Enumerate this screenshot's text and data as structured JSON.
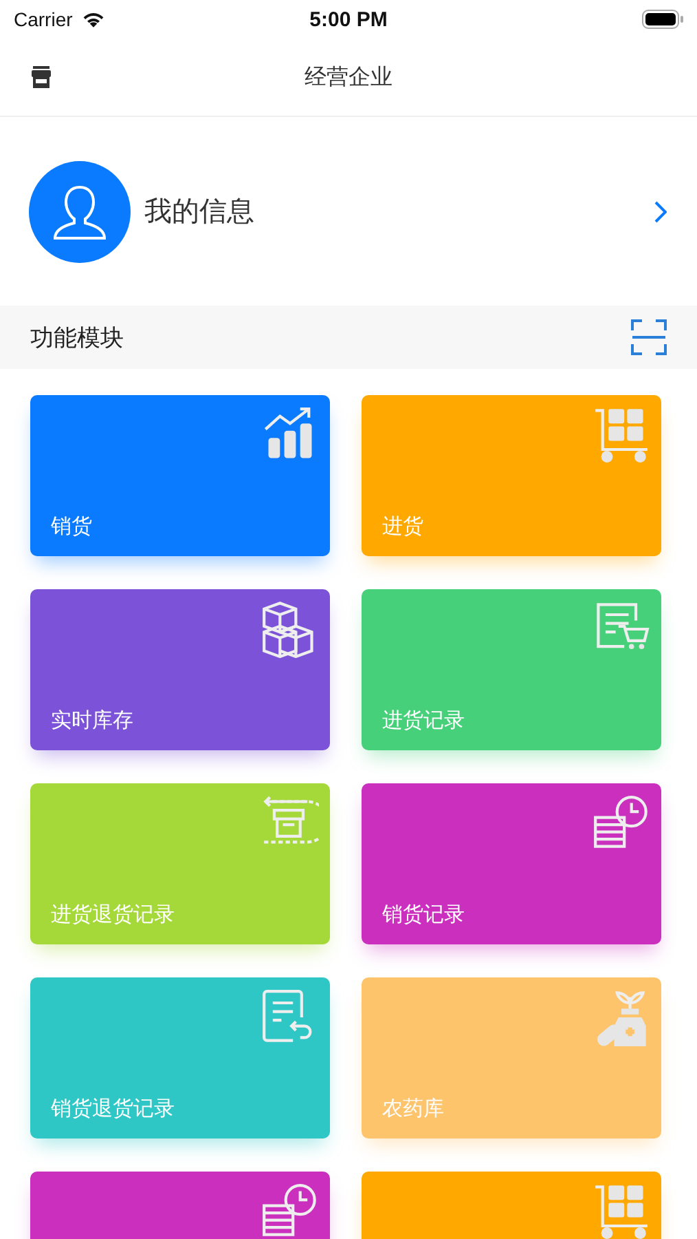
{
  "status_bar": {
    "carrier": "Carrier",
    "time": "5:00 PM"
  },
  "nav_bar": {
    "title": "经营企业"
  },
  "profile": {
    "label": "我的信息"
  },
  "section": {
    "title": "功能模块"
  },
  "modules": [
    {
      "label": "销货",
      "color": "#0a7aff",
      "kind": "chart"
    },
    {
      "label": "进货",
      "color": "#ffa800",
      "kind": "cart"
    },
    {
      "label": "实时库存",
      "color": "#7b52d8",
      "kind": "boxes"
    },
    {
      "label": "进货记录",
      "color": "#47d07a",
      "kind": "list-cart"
    },
    {
      "label": "进货退货记录",
      "color": "#a5d93a",
      "kind": "return-box"
    },
    {
      "label": "销货记录",
      "color": "#cb2fbd",
      "kind": "coins-clock"
    },
    {
      "label": "销货退货记录",
      "color": "#2fc6c6",
      "kind": "doc-return"
    },
    {
      "label": "农药库",
      "color": "#fec46c",
      "kind": "plant-medicine"
    },
    {
      "color": "#cb2fbd",
      "kind": "coins-clock"
    },
    {
      "color": "#ffa800",
      "kind": "cart"
    }
  ]
}
